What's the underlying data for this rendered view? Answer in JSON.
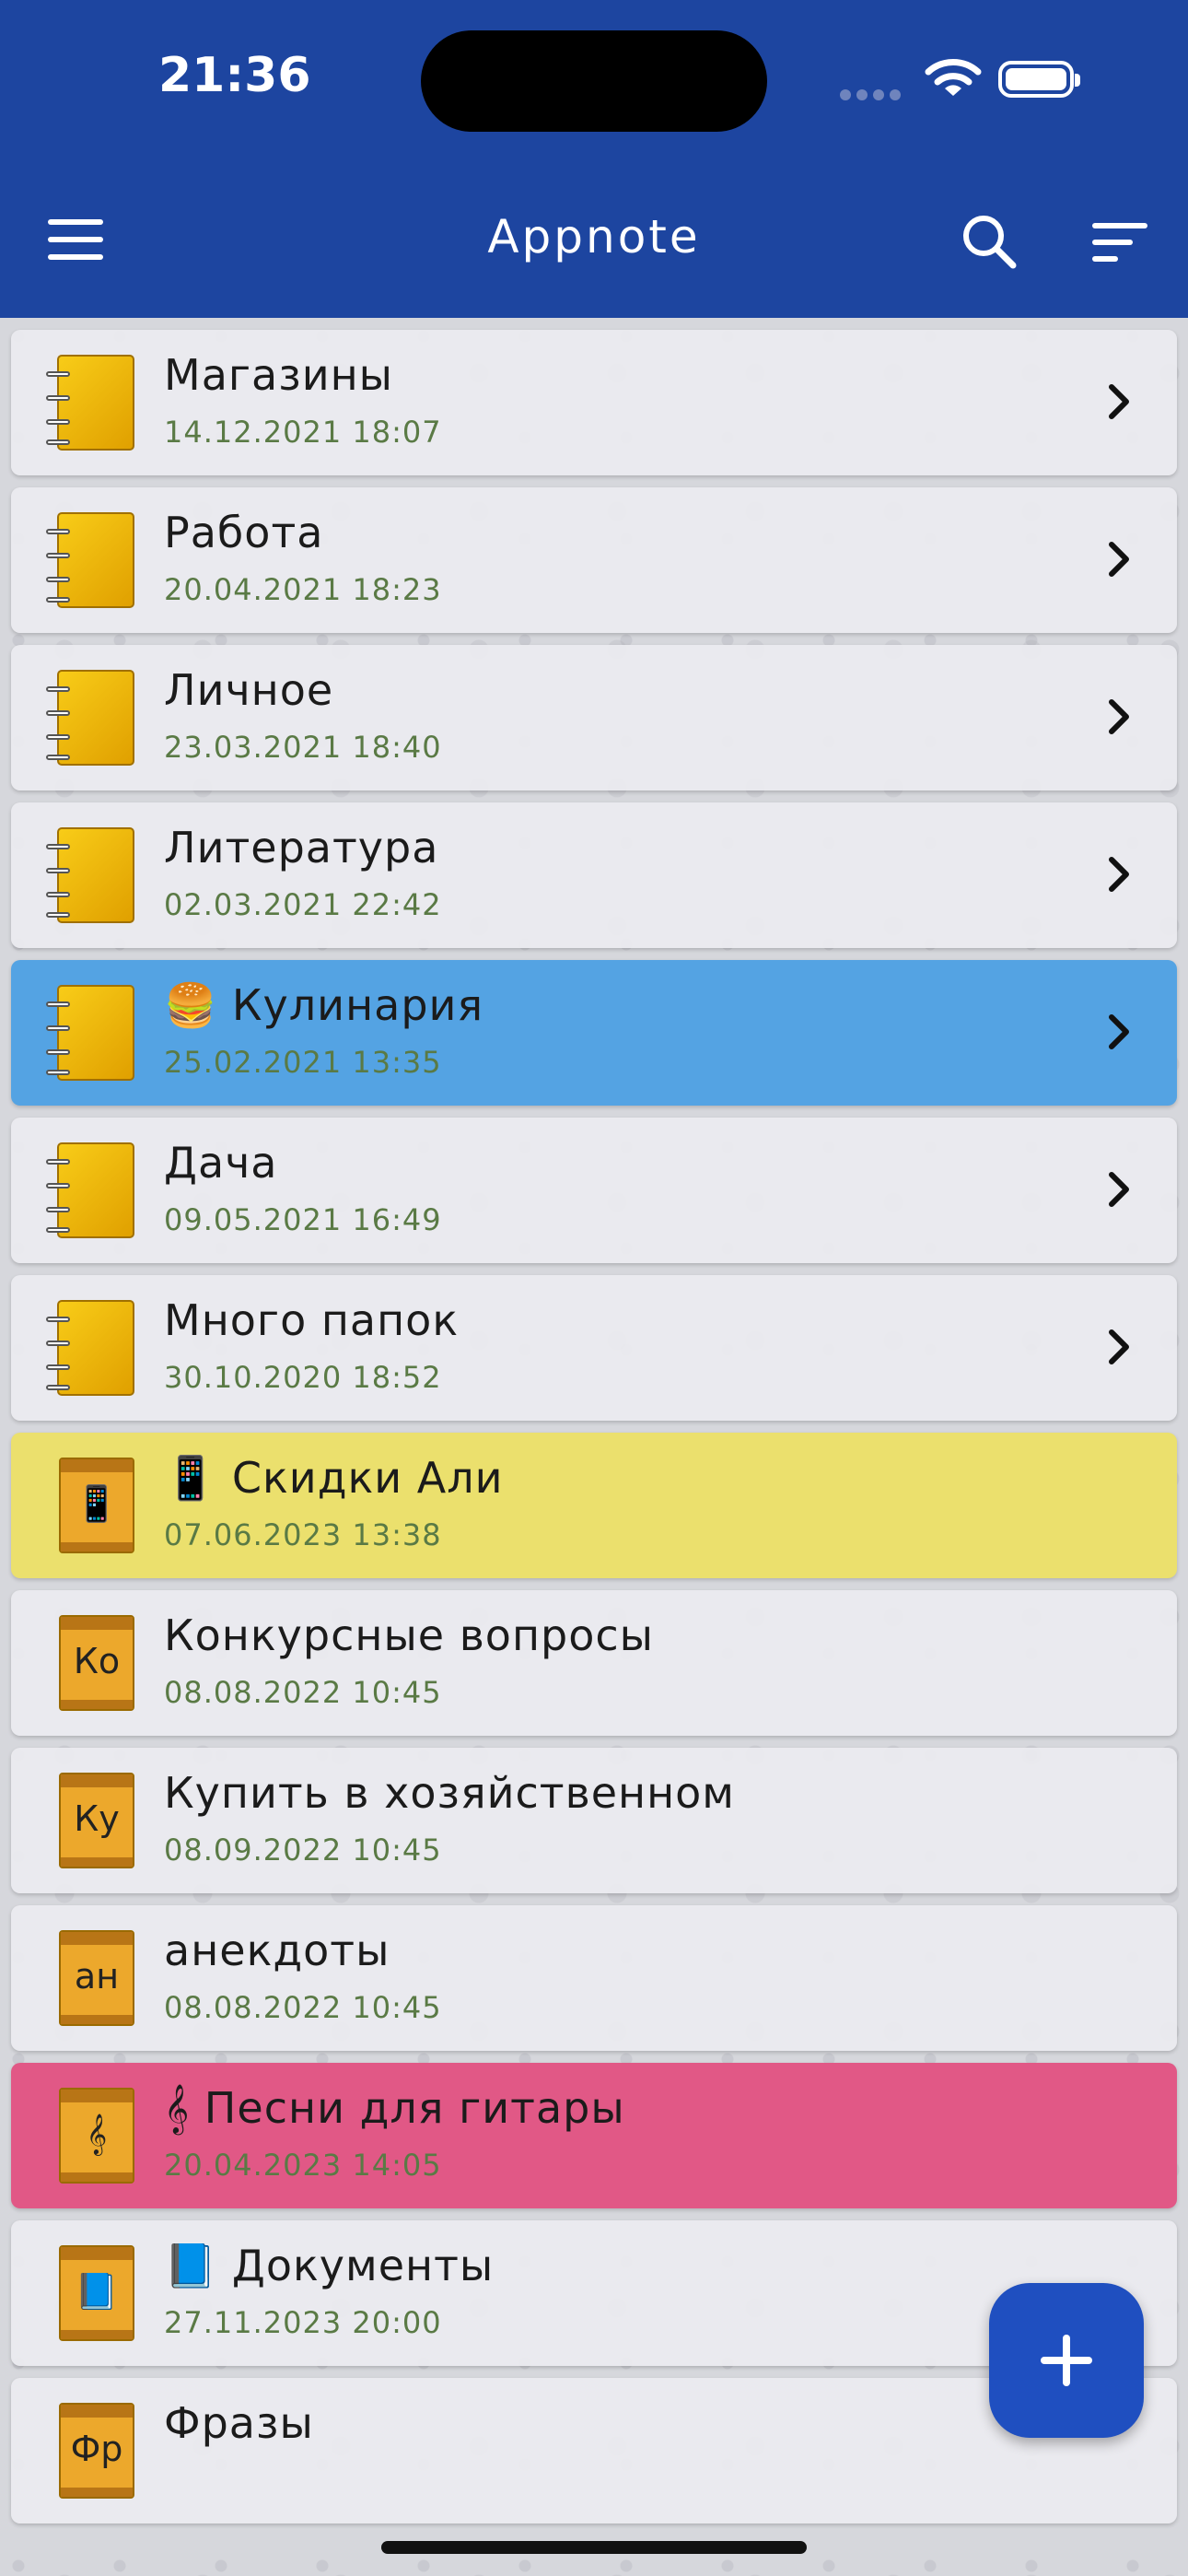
{
  "status": {
    "time": "21:36"
  },
  "header": {
    "title": "Appnote"
  },
  "notebooks": [
    {
      "title": "Магазины",
      "date": "14.12.2021 18:07",
      "kind": "notebook",
      "color": "",
      "chevron": true
    },
    {
      "title": "Работа",
      "date": "20.04.2021 18:23",
      "kind": "notebook",
      "color": "",
      "chevron": true
    },
    {
      "title": "Личное",
      "date": "23.03.2021 18:40",
      "kind": "notebook",
      "color": "",
      "chevron": true
    },
    {
      "title": "Литература",
      "date": "02.03.2021 22:42",
      "kind": "notebook",
      "color": "",
      "chevron": true
    },
    {
      "title": "🍔 Кулинария",
      "date": "25.02.2021 13:35",
      "kind": "notebook",
      "color": "blue",
      "chevron": true
    },
    {
      "title": "Дача",
      "date": "09.05.2021 16:49",
      "kind": "notebook",
      "color": "",
      "chevron": true
    },
    {
      "title": "Много папок",
      "date": "30.10.2020 18:52",
      "kind": "notebook",
      "color": "",
      "chevron": true
    },
    {
      "title": "📱 Скидки Али",
      "date": "07.06.2023 13:38",
      "kind": "note",
      "abbr": "📱",
      "color": "yellow",
      "chevron": false
    },
    {
      "title": "Конкурсные вопросы",
      "date": "08.08.2022 10:45",
      "kind": "note",
      "abbr": "Ко",
      "color": "",
      "chevron": false
    },
    {
      "title": "Купить в хозяйственном",
      "date": "08.09.2022 10:45",
      "kind": "note",
      "abbr": "Ку",
      "color": "",
      "chevron": false
    },
    {
      "title": "анекдоты",
      "date": "08.08.2022 10:45",
      "kind": "note",
      "abbr": "ан",
      "color": "",
      "chevron": false
    },
    {
      "title": "𝄞 Песни для гитары",
      "date": "20.04.2023 14:05",
      "kind": "note",
      "abbr": "𝄞",
      "color": "pink",
      "chevron": false
    },
    {
      "title": "📘 Документы",
      "date": "27.11.2023 20:00",
      "kind": "note",
      "abbr": "📘",
      "color": "",
      "chevron": false
    },
    {
      "title": "Фразы",
      "date": "",
      "kind": "note",
      "abbr": "Фр",
      "color": "",
      "chevron": false
    }
  ],
  "icons": {
    "menu": "hamburger-menu-icon",
    "search": "magnifier-icon",
    "sort": "sort-lines-icon",
    "add": "plus-icon"
  },
  "colors": {
    "header": "#1d45a0",
    "blue": "#54a3e3",
    "yellow": "#ebe06d",
    "pink": "#e15886",
    "fab": "#1f4fc0"
  }
}
